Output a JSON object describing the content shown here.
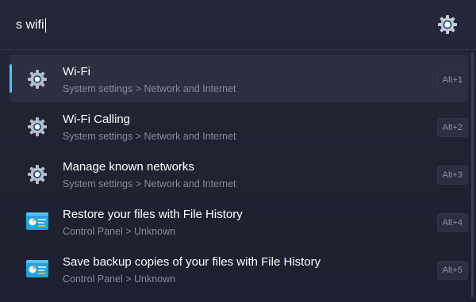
{
  "search": {
    "query": "s wifi"
  },
  "results": [
    {
      "title": "Wi-Fi",
      "subtitle": "System settings > Network and Internet",
      "shortcut": "Alt+1",
      "icon": "gear-icon",
      "selected": true
    },
    {
      "title": "Wi-Fi Calling",
      "subtitle": "System settings > Network and Internet",
      "shortcut": "Alt+2",
      "icon": "gear-icon",
      "selected": false
    },
    {
      "title": "Manage known networks",
      "subtitle": "System settings > Network and Internet",
      "shortcut": "Alt+3",
      "icon": "gear-icon",
      "selected": false
    },
    {
      "title": "Restore your files with File History",
      "subtitle": "Control Panel > Unknown",
      "shortcut": "Alt+4",
      "icon": "control-panel-icon",
      "selected": false
    },
    {
      "title": "Save backup copies of your files with File History",
      "subtitle": "Control Panel > Unknown",
      "shortcut": "Alt+5",
      "icon": "control-panel-icon",
      "selected": false
    }
  ],
  "colors": {
    "accent": "#4cc2ff",
    "background": "#1f2232",
    "selected_row": "#2b2f40",
    "subtitle_text": "#868a99"
  }
}
